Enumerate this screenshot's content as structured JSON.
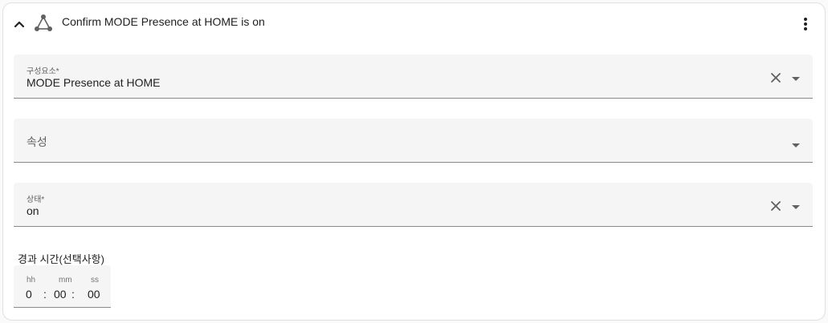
{
  "header": {
    "title": "Confirm MODE Presence at HOME is on",
    "collapse_icon": "chevron-up-icon",
    "type_icon": "state-condition-icon",
    "menu_icon": "more-vertical-icon"
  },
  "fields": {
    "entity": {
      "label": "구성요소*",
      "value": "MODE Presence at HOME"
    },
    "attribute": {
      "placeholder": "속성"
    },
    "state": {
      "label": "상태*",
      "value": "on"
    }
  },
  "duration": {
    "label": "경과 시간(선택사항)",
    "units": {
      "hours": "hh",
      "minutes": "mm",
      "seconds": "ss"
    },
    "values": {
      "hours": "0",
      "minutes": "00",
      "seconds": "00"
    },
    "separator": ":"
  },
  "colors": {
    "field_bg": "#f5f5f5",
    "underline": "#8a8a8a",
    "card_border": "#e0e0e0",
    "icon": "#616161"
  }
}
